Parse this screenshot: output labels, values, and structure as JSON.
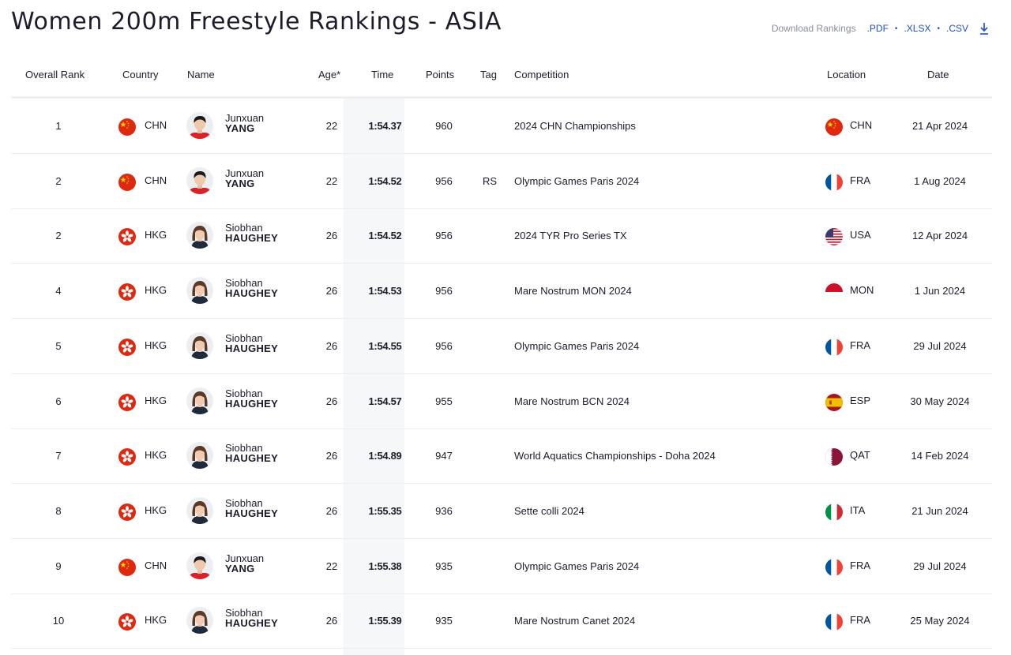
{
  "page": {
    "title": "Women 200m Freestyle Rankings - ASIA",
    "download_label": "Download Rankings",
    "download_links": [
      ".PDF",
      ".XLSX",
      ".CSV"
    ],
    "download_icon": "download-icon"
  },
  "table": {
    "headers": {
      "rank": "Overall Rank",
      "country": "Country",
      "name": "Name",
      "age": "Age*",
      "time": "Time",
      "points": "Points",
      "tag": "Tag",
      "competition": "Competition",
      "location": "Location",
      "date": "Date"
    },
    "rows": [
      {
        "rank": "1",
        "country": "CHN",
        "first": "Junxuan",
        "last": "YANG",
        "age": "22",
        "time": "1:54.37",
        "points": "960",
        "tag": "",
        "competition": "2024 CHN Championships",
        "location": "CHN",
        "date": "21 Apr 2024"
      },
      {
        "rank": "2",
        "country": "CHN",
        "first": "Junxuan",
        "last": "YANG",
        "age": "22",
        "time": "1:54.52",
        "points": "956",
        "tag": "RS",
        "competition": "Olympic Games Paris 2024",
        "location": "FRA",
        "date": "1 Aug 2024"
      },
      {
        "rank": "2",
        "country": "HKG",
        "first": "Siobhan",
        "last": "HAUGHEY",
        "age": "26",
        "time": "1:54.52",
        "points": "956",
        "tag": "",
        "competition": "2024 TYR Pro Series TX",
        "location": "USA",
        "date": "12 Apr 2024"
      },
      {
        "rank": "4",
        "country": "HKG",
        "first": "Siobhan",
        "last": "HAUGHEY",
        "age": "26",
        "time": "1:54.53",
        "points": "956",
        "tag": "",
        "competition": "Mare Nostrum MON 2024",
        "location": "MON",
        "date": "1 Jun 2024"
      },
      {
        "rank": "5",
        "country": "HKG",
        "first": "Siobhan",
        "last": "HAUGHEY",
        "age": "26",
        "time": "1:54.55",
        "points": "956",
        "tag": "",
        "competition": "Olympic Games Paris 2024",
        "location": "FRA",
        "date": "29 Jul 2024"
      },
      {
        "rank": "6",
        "country": "HKG",
        "first": "Siobhan",
        "last": "HAUGHEY",
        "age": "26",
        "time": "1:54.57",
        "points": "955",
        "tag": "",
        "competition": "Mare Nostrum BCN 2024",
        "location": "ESP",
        "date": "30 May 2024"
      },
      {
        "rank": "7",
        "country": "HKG",
        "first": "Siobhan",
        "last": "HAUGHEY",
        "age": "26",
        "time": "1:54.89",
        "points": "947",
        "tag": "",
        "competition": "World Aquatics Championships - Doha 2024",
        "location": "QAT",
        "date": "14 Feb 2024"
      },
      {
        "rank": "8",
        "country": "HKG",
        "first": "Siobhan",
        "last": "HAUGHEY",
        "age": "26",
        "time": "1:55.35",
        "points": "936",
        "tag": "",
        "competition": "Sette colli 2024",
        "location": "ITA",
        "date": "21 Jun 2024"
      },
      {
        "rank": "9",
        "country": "CHN",
        "first": "Junxuan",
        "last": "YANG",
        "age": "22",
        "time": "1:55.38",
        "points": "935",
        "tag": "",
        "competition": "Olympic Games Paris 2024",
        "location": "FRA",
        "date": "29 Jul 2024"
      },
      {
        "rank": "10",
        "country": "HKG",
        "first": "Siobhan",
        "last": "HAUGHEY",
        "age": "26",
        "time": "1:55.39",
        "points": "935",
        "tag": "",
        "competition": "Mare Nostrum Canet 2024",
        "location": "FRA",
        "date": "25 May 2024"
      }
    ]
  },
  "colors": {
    "link": "#1a53c2",
    "time_column_bg": "#f6f7f9",
    "text": "#1c1c2b"
  }
}
